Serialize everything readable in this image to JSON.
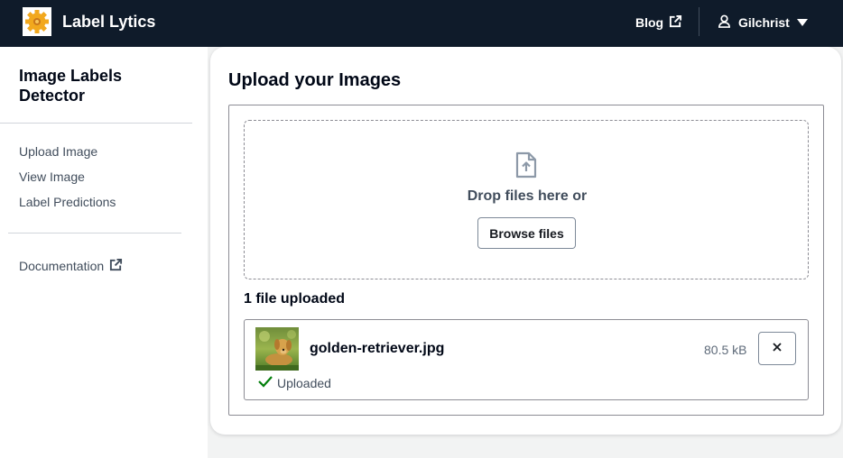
{
  "app": {
    "brand": "Label Lytics",
    "logo_icon": "gear-logo-icon",
    "blog_label": "Blog",
    "user_name": "Gilchrist"
  },
  "sidebar": {
    "title": "Image Labels Detector",
    "items": [
      {
        "label": "Upload Image"
      },
      {
        "label": "View Image"
      },
      {
        "label": "Label Predictions"
      }
    ],
    "documentation_label": "Documentation"
  },
  "main": {
    "title": "Upload your Images",
    "drop_text": "Drop files here or",
    "browse_label": "Browse files",
    "uploaded_count": "1 file uploaded",
    "files": [
      {
        "name": "golden-retriever.jpg",
        "size": "80.5 kB",
        "status": "Uploaded"
      }
    ]
  },
  "colors": {
    "nav_bg": "#0f1b2a",
    "success": "#037f0c",
    "logo": "#f2a81d"
  }
}
